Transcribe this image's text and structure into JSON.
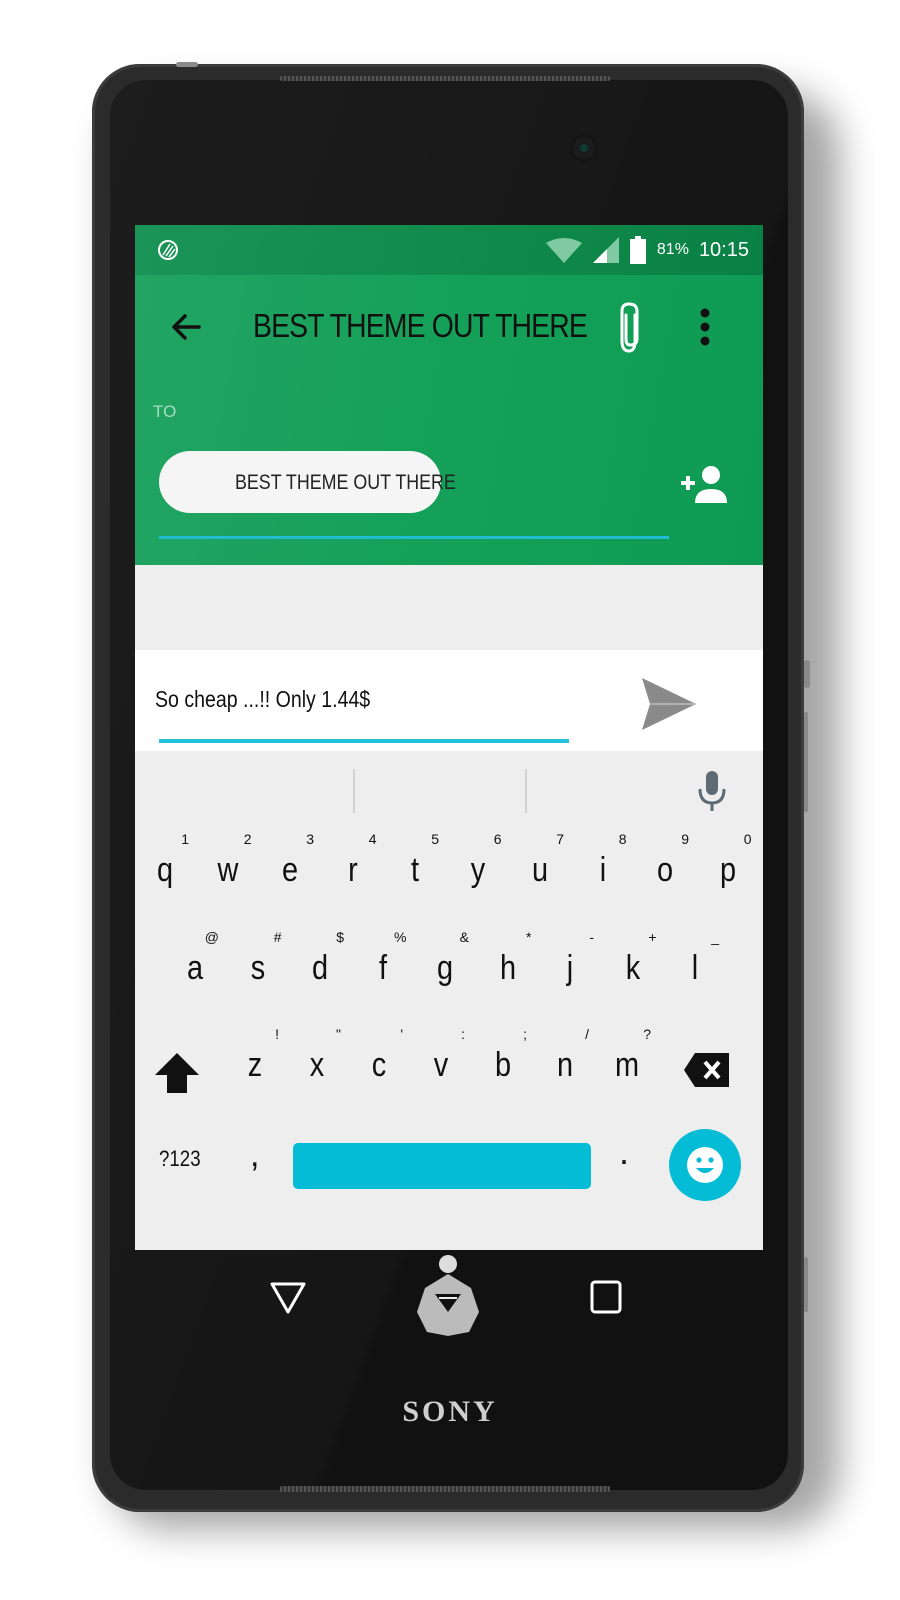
{
  "device": {
    "brand": "SONY"
  },
  "status_bar": {
    "left_icon": "app-notification-icon",
    "wifi_icon": "wifi-icon",
    "signal_icon": "signal-icon",
    "battery_icon": "battery-icon",
    "battery_percent": "81%",
    "time": "10:15"
  },
  "app_bar": {
    "back_icon": "arrow-back-icon",
    "title": "BEST THEME OUT THERE",
    "attach_icon": "paperclip-icon",
    "more_icon": "more-vert-icon",
    "to_label": "TO",
    "recipient_chip": "BEST THEME OUT THERE",
    "add_recipient_icon": "add-person-icon"
  },
  "compose": {
    "text": "So cheap ...!! Only 1.44$",
    "send_icon": "send-icon"
  },
  "keyboard": {
    "mic_icon": "mic-icon",
    "row1": [
      {
        "key": "q",
        "hint": "1"
      },
      {
        "key": "w",
        "hint": "2"
      },
      {
        "key": "e",
        "hint": "3"
      },
      {
        "key": "r",
        "hint": "4"
      },
      {
        "key": "t",
        "hint": "5"
      },
      {
        "key": "y",
        "hint": "6"
      },
      {
        "key": "u",
        "hint": "7"
      },
      {
        "key": "i",
        "hint": "8"
      },
      {
        "key": "o",
        "hint": "9"
      },
      {
        "key": "p",
        "hint": "0"
      }
    ],
    "row2": [
      {
        "key": "a",
        "hint": "@"
      },
      {
        "key": "s",
        "hint": "#"
      },
      {
        "key": "d",
        "hint": "$"
      },
      {
        "key": "f",
        "hint": "%"
      },
      {
        "key": "g",
        "hint": "&"
      },
      {
        "key": "h",
        "hint": "*"
      },
      {
        "key": "j",
        "hint": "-"
      },
      {
        "key": "k",
        "hint": "+"
      },
      {
        "key": "l",
        "hint": "_"
      }
    ],
    "row3": [
      {
        "key": "z",
        "hint": "!"
      },
      {
        "key": "x",
        "hint": "\""
      },
      {
        "key": "c",
        "hint": "'"
      },
      {
        "key": "v",
        "hint": ":"
      },
      {
        "key": "b",
        "hint": ";"
      },
      {
        "key": "n",
        "hint": "/"
      },
      {
        "key": "m",
        "hint": "?"
      }
    ],
    "shift_icon": "shift-icon",
    "backspace_icon": "backspace-icon",
    "symbols_label": "?123",
    "comma_label": ",",
    "period_label": ".",
    "emoji_icon": "emoji-icon",
    "accent_color": "#04bcd6"
  },
  "nav_bar": {
    "back_icon": "nav-back-icon",
    "home_icon": "superman-home-icon",
    "recents_icon": "nav-recents-icon"
  },
  "theme": {
    "primary": "#13a057",
    "status_bar": "#0f8a4a",
    "accent": "#1fbcd2"
  }
}
